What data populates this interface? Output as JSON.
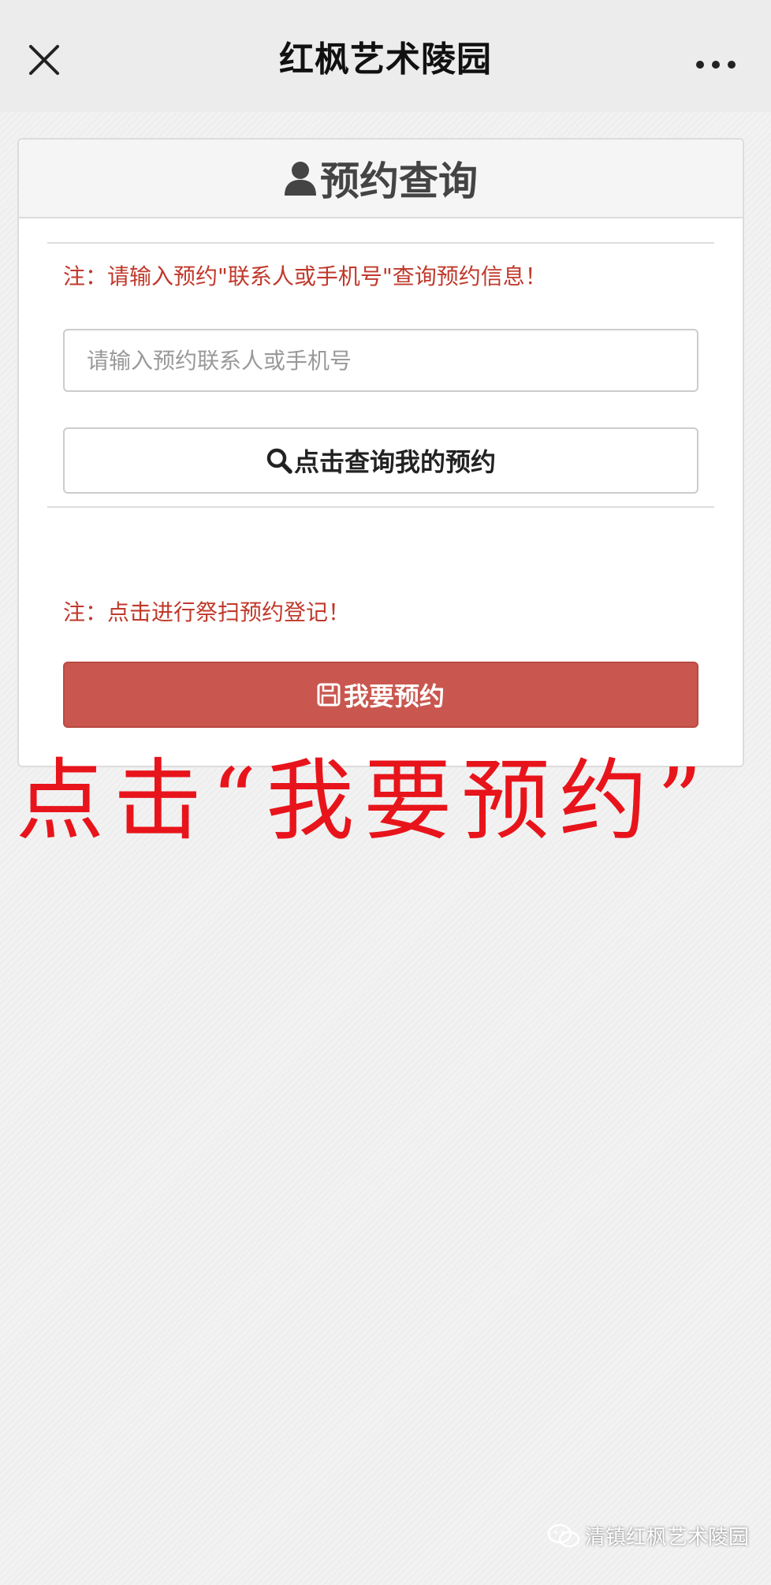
{
  "navbar": {
    "title": "红枫艺术陵园",
    "close_icon": "close-icon",
    "more_icon": "more-icon"
  },
  "panel": {
    "title": "预约查询",
    "title_icon": "user-icon",
    "query_note": "注：请输入预约\"联系人或手机号\"查询预约信息！",
    "search_placeholder": "请输入预约联系人或手机号",
    "search_value": "",
    "query_button_label": "点击查询我的预约",
    "query_button_icon": "search-icon",
    "reserve_note": "注：点击进行祭扫预约登记！",
    "reserve_button_label": "我要预约",
    "reserve_button_icon": "save-icon"
  },
  "annotation": "点击“我要预约”",
  "watermark": {
    "text": "清镇红枫艺术陵园",
    "icon": "wechat-icon"
  },
  "colors": {
    "navbar_bg": "#ececec",
    "note_red": "#c0392b",
    "button_red": "#c9574f",
    "annotation_red": "#e8141b"
  }
}
